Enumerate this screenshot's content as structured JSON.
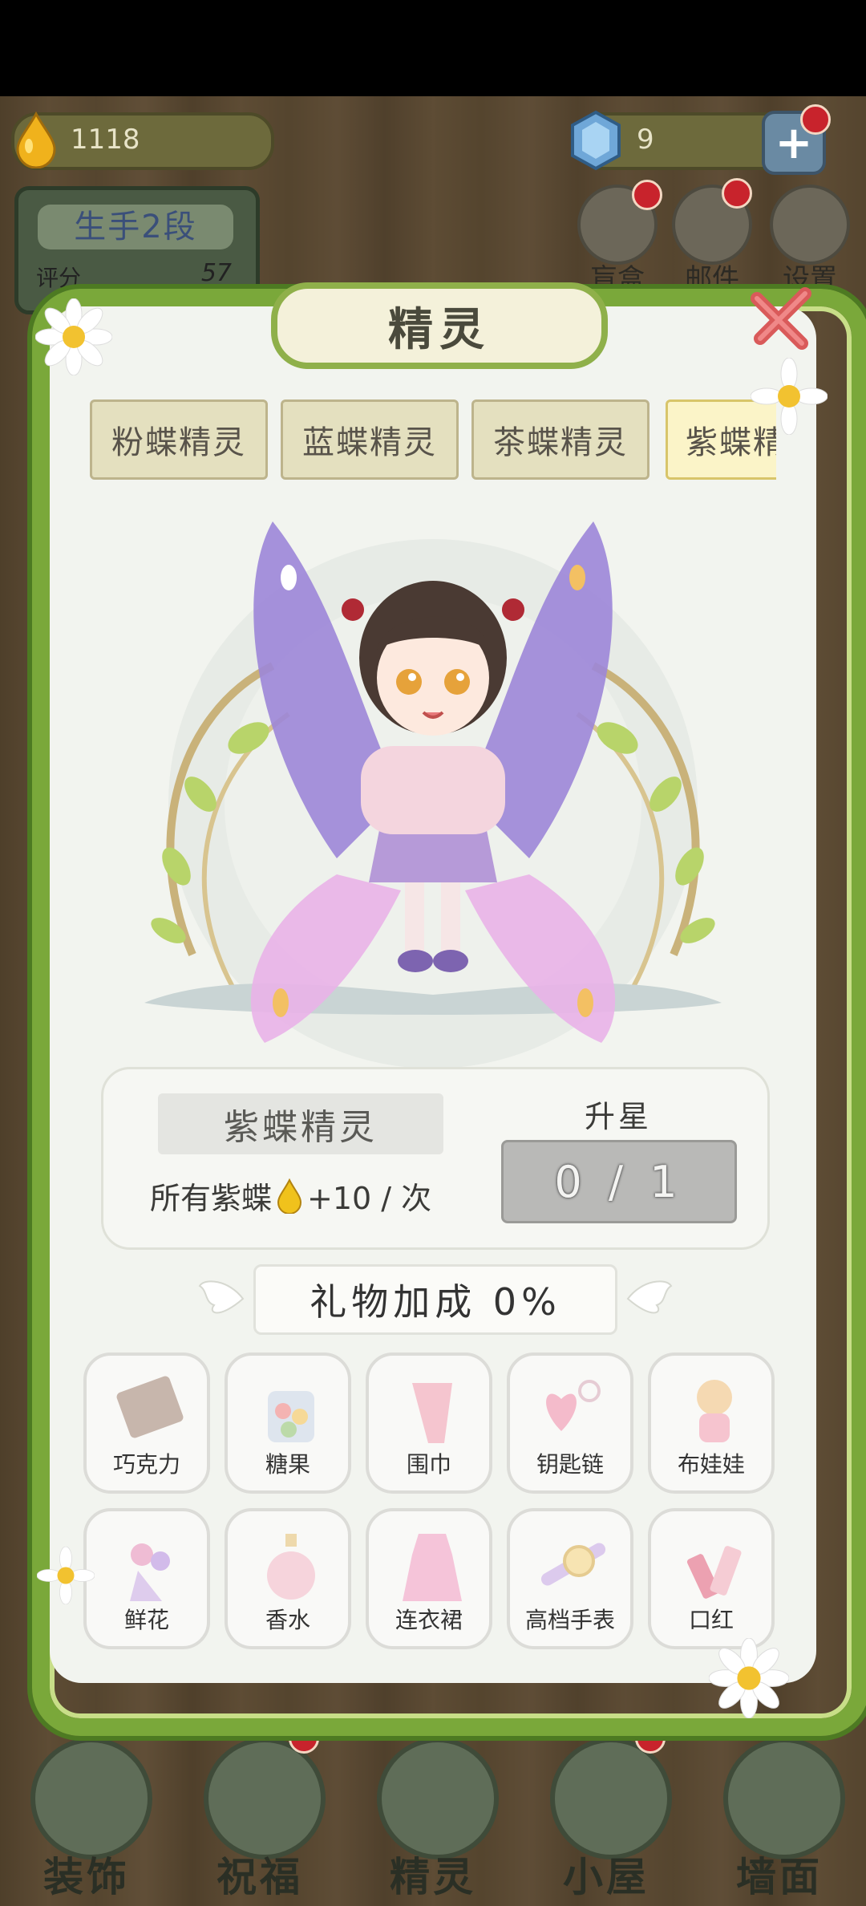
{
  "hud": {
    "drops": "1118",
    "gems": "9",
    "rank": "生手2段",
    "score_label": "评分",
    "score": "57"
  },
  "top_icons": [
    {
      "label": "盲盒"
    },
    {
      "label": "邮件"
    },
    {
      "label": "设置"
    }
  ],
  "panel": {
    "title": "精灵",
    "tabs": [
      "粉蝶精灵",
      "蓝蝶精灵",
      "茶蝶精灵",
      "紫蝶精"
    ],
    "active_tab": 3
  },
  "info": {
    "name": "紫蝶精灵",
    "bonus_prefix": "所有紫蝶",
    "bonus_suffix": "+10 / 次",
    "upstar_label": "升星",
    "upstar_progress": "0 / 1"
  },
  "gifts": {
    "title": "礼物加成 0%",
    "items": [
      {
        "label": "巧克力"
      },
      {
        "label": "糖果"
      },
      {
        "label": "围巾"
      },
      {
        "label": "钥匙链"
      },
      {
        "label": "布娃娃"
      },
      {
        "label": "鲜花"
      },
      {
        "label": "香水"
      },
      {
        "label": "连衣裙"
      },
      {
        "label": "高档手表"
      },
      {
        "label": "口红"
      }
    ]
  },
  "nav": [
    {
      "label": "装饰"
    },
    {
      "label": "祝福"
    },
    {
      "label": "精灵"
    },
    {
      "label": "小屋"
    },
    {
      "label": "墙面"
    }
  ],
  "colors": {
    "vine": "#7aa83a",
    "panel": "#f2f4ef",
    "tab_active": "#fbf4c8",
    "alert": "#c8232c"
  }
}
